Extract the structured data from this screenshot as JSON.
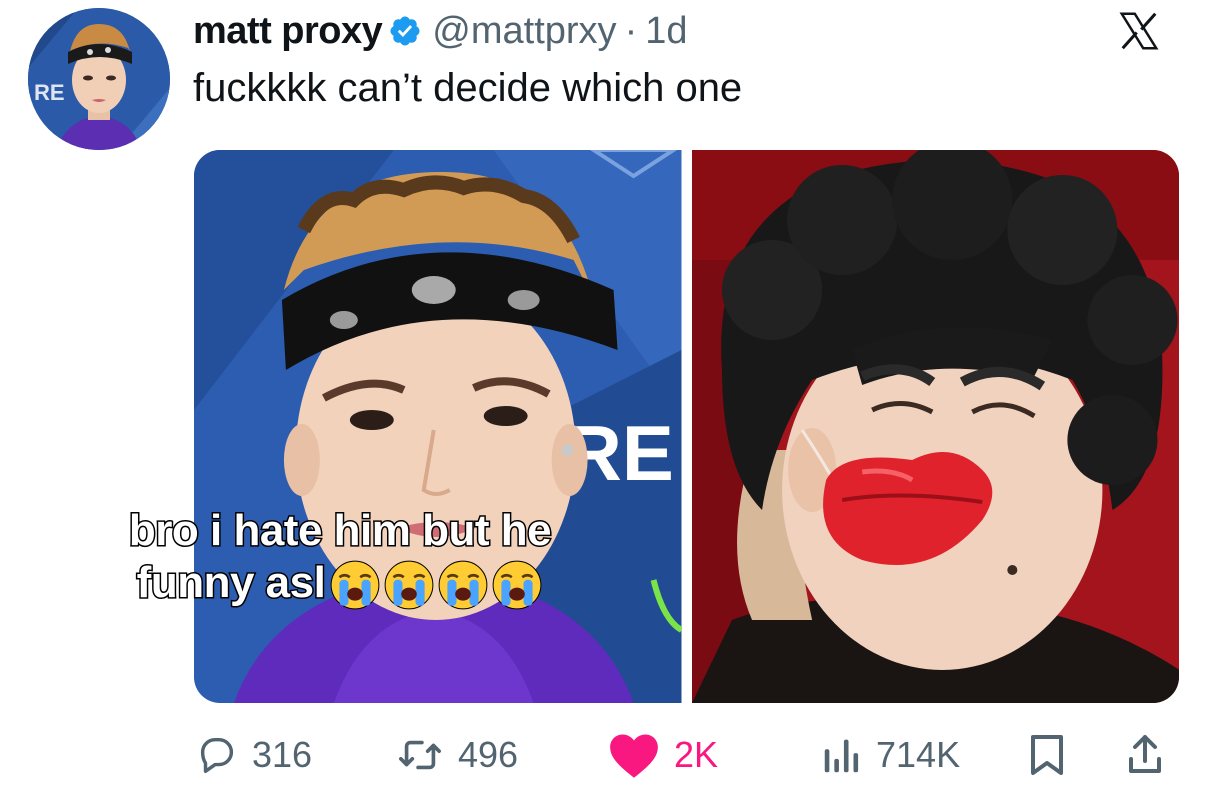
{
  "post": {
    "display_name": "matt proxy",
    "handle": "@mattprxy",
    "separator": "·",
    "age": "1d",
    "text": "fuckkkk can’t decide which one",
    "avatar_sign_text": "RE",
    "backdrop_sign_text": "RE"
  },
  "overlay_caption": {
    "line1": "bro i hate him but he",
    "line2": "funny asl",
    "emoji_count": 4,
    "emoji_name": "loudly-crying-face"
  },
  "actions": {
    "reply_count": "316",
    "repost_count": "496",
    "like_count": "2K",
    "view_count": "714K"
  },
  "icons": {
    "verified": "verified-badge-icon",
    "brand": "x-logo-icon",
    "reply": "reply-bubble-icon",
    "repost": "repost-arrows-icon",
    "like": "heart-icon",
    "views": "views-bar-chart-icon",
    "bookmark": "bookmark-icon",
    "share": "share-upload-icon"
  },
  "colors": {
    "text_primary": "#0f1419",
    "text_secondary": "#536471",
    "verified_blue": "#1d9bf0",
    "like_pink": "#f91880",
    "sign_blue": "#2a5aa8",
    "curtain_red": "#a4141c"
  }
}
